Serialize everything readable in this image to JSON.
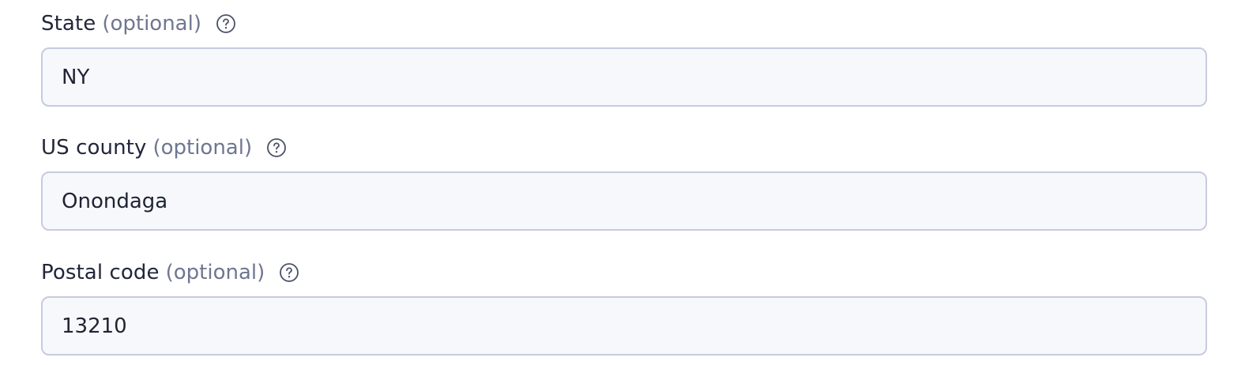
{
  "fields": [
    {
      "label": "State",
      "optional": "(optional)",
      "value": "NY",
      "help_icon": "question-circle-icon"
    },
    {
      "label": "US county",
      "optional": "(optional)",
      "value": "Onondaga",
      "help_icon": "question-circle-icon"
    },
    {
      "label": "Postal code",
      "optional": "(optional)",
      "value": "13210",
      "help_icon": "question-circle-icon"
    }
  ],
  "colors": {
    "label": "#22263a",
    "optional": "#6f7691",
    "input_border": "#c6cbe0",
    "input_bg": "#f6f8fc"
  }
}
